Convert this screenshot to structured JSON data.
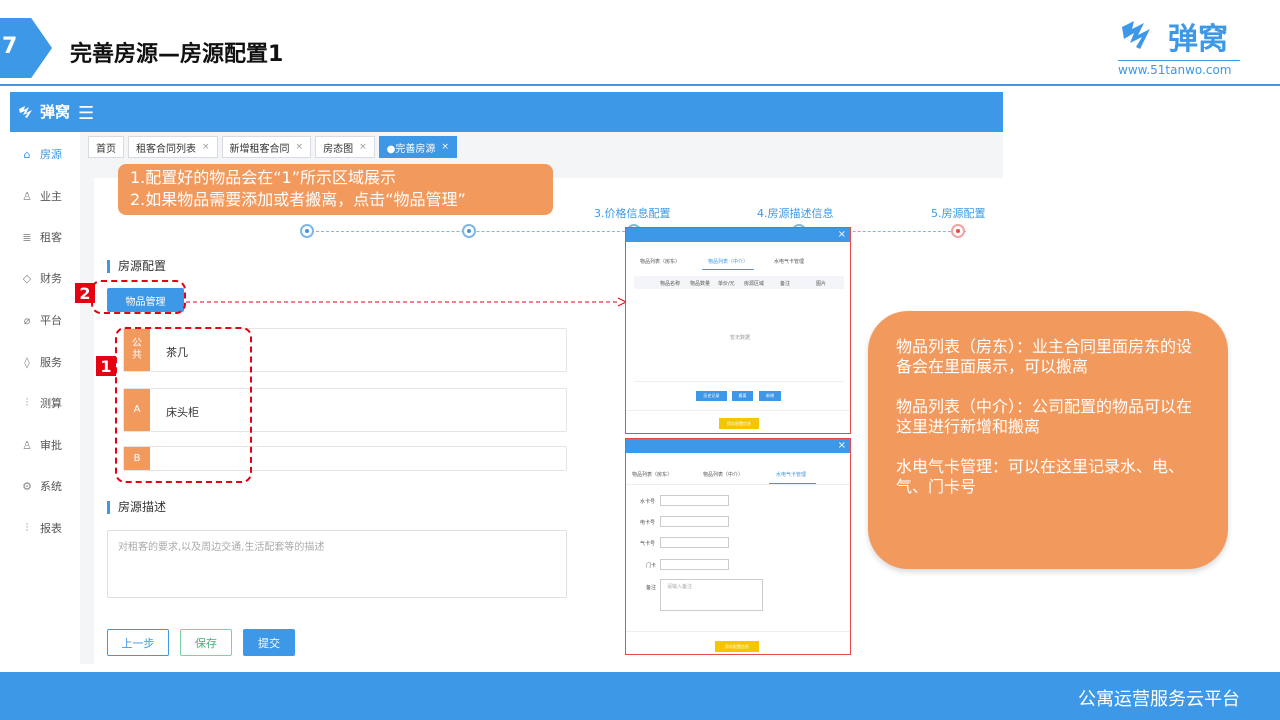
{
  "slide": {
    "number": "7",
    "title": "完善房源—房源配置1"
  },
  "brand": {
    "name": "弹窝",
    "url": "www.51tanwo.com"
  },
  "app": {
    "brand": "弹窝",
    "menu_icon": "hamburger-icon",
    "sidebar": [
      {
        "label": "房源",
        "icon": "home-icon",
        "active": true
      },
      {
        "label": "业主",
        "icon": "user-icon"
      },
      {
        "label": "租客",
        "icon": "database-icon"
      },
      {
        "label": "财务",
        "icon": "diamond-icon"
      },
      {
        "label": "平台",
        "icon": "leaf-icon"
      },
      {
        "label": "服务",
        "icon": "tag-icon"
      },
      {
        "label": "测算",
        "icon": "sliders-icon"
      },
      {
        "label": "审批",
        "icon": "person-icon"
      },
      {
        "label": "系统",
        "icon": "gear-icon"
      },
      {
        "label": "报表",
        "icon": "sliders-icon"
      }
    ],
    "tabs": [
      {
        "label": "首页"
      },
      {
        "label": "租客合同列表",
        "close": "×"
      },
      {
        "label": "新增租客合同",
        "close": "×"
      },
      {
        "label": "房态图",
        "close": "×"
      },
      {
        "label": "●完善房源",
        "close": "×",
        "active": true
      }
    ],
    "steps": [
      {
        "label": "3.价格信息配置"
      },
      {
        "label": "4.房源描述信息"
      },
      {
        "label": "5.房源配置"
      }
    ],
    "config_section": "房源配置",
    "goods_button": "物品管理",
    "items": [
      {
        "tag": "公\n共",
        "name": "茶几"
      },
      {
        "tag": "A",
        "name": "床头柜"
      },
      {
        "tag": "B",
        "name": ""
      }
    ],
    "desc_section": "房源描述",
    "desc_placeholder": "对租客的要求,以及周边交通,生活配套等的描述",
    "buttons": {
      "prev": "上一步",
      "save": "保存",
      "submit": "提交"
    }
  },
  "callout_top": {
    "line1": "1.配置好的物品会在“1”所示区域展示",
    "line2": "2.如果物品需要添加或者搬离，点击“物品管理”"
  },
  "badges": {
    "one": "1",
    "two": "2"
  },
  "modal1": {
    "close": "×",
    "tabs": [
      "物品列表（房东）",
      "物品列表（中介）",
      "水电气卡管理"
    ],
    "columns": [
      "物品名称",
      "物品数量",
      "单价/元",
      "房源区域",
      "备注",
      "图片"
    ],
    "empty": "暂无数据",
    "btns": [
      "历史记录",
      "搬离",
      "新增"
    ],
    "save": "保存配置信息"
  },
  "modal2": {
    "close": "×",
    "tabs": [
      "物品列表（房东）",
      "物品列表（中介）",
      "水电气卡管理"
    ],
    "fields": [
      "水卡号",
      "电卡号",
      "气卡号",
      "门卡",
      "备注"
    ],
    "remark_placeholder": "请输入备注",
    "save": "保存配置信息"
  },
  "callout_right": {
    "p1": "物品列表（房东）：业主合同里面房东的设备会在里面展示，可以搬离",
    "p2": "物品列表（中介）：公司配置的物品可以在这里进行新增和搬离",
    "p3": "水电气卡管理：可以在这里记录水、电、气、门卡号"
  },
  "footer": "公寓运营服务云平台"
}
